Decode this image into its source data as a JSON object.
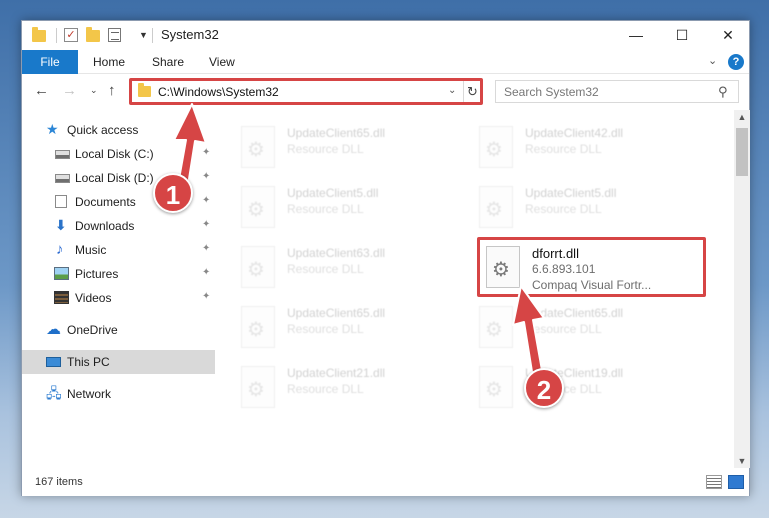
{
  "window": {
    "title": "System32",
    "controls": {
      "minimize": "—",
      "maximize": "☐",
      "close": "✕"
    }
  },
  "ribbon": {
    "tabs": [
      "File",
      "Home",
      "Share",
      "View"
    ],
    "help": "?"
  },
  "navigation": {
    "address": "C:\\Windows\\System32",
    "search_placeholder": "Search System32"
  },
  "sidebar": {
    "items": [
      {
        "label": "Quick access",
        "icon": "star-icon"
      },
      {
        "label": "Local Disk (C:)",
        "icon": "drive-icon",
        "pinned": true
      },
      {
        "label": "Local Disk (D:)",
        "icon": "drive-icon",
        "pinned": true
      },
      {
        "label": "Documents",
        "icon": "documents-icon",
        "pinned": true
      },
      {
        "label": "Downloads",
        "icon": "download-icon",
        "pinned": true
      },
      {
        "label": "Music",
        "icon": "music-icon",
        "pinned": true
      },
      {
        "label": "Pictures",
        "icon": "pictures-icon",
        "pinned": true
      },
      {
        "label": "Videos",
        "icon": "videos-icon",
        "pinned": true
      },
      {
        "label": "OneDrive",
        "icon": "cloud-icon"
      },
      {
        "label": "This PC",
        "icon": "computer-icon",
        "selected": true
      },
      {
        "label": "Network",
        "icon": "network-icon"
      }
    ]
  },
  "files": {
    "ghost": [
      {
        "name": "UpdateClient65.dll",
        "type": "Resource DLL"
      },
      {
        "name": "UpdateClient42.dll",
        "type": "Resource DLL"
      },
      {
        "name": "UpdateClient5.dll",
        "type": "Resource DLL"
      },
      {
        "name": "UpdateClient5.dll",
        "type": "Resource DLL"
      },
      {
        "name": "UpdateClient63.dll",
        "type": "Resource DLL"
      },
      {
        "name": "UpdateClient65.dll",
        "type": "Resource DLL"
      },
      {
        "name": "UpdateClient65.dll",
        "type": "Resource DLL"
      },
      {
        "name": "UpdateClient21.dll",
        "type": "Resource DLL"
      },
      {
        "name": "UpdateClient19.dll",
        "type": "Resource DLL"
      }
    ],
    "highlighted": {
      "name": "dforrt.dll",
      "version": "6.6.893.101",
      "description": "Compaq Visual Fortr..."
    }
  },
  "status": {
    "item_count": "167 items"
  },
  "callouts": {
    "step1": "1",
    "step2": "2"
  },
  "colors": {
    "accent": "#1979ca",
    "highlight": "#d64545",
    "folder": "#f3c649"
  }
}
